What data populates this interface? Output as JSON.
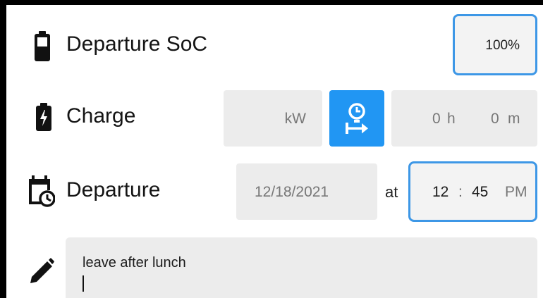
{
  "departure_soc": {
    "label": "Departure SoC",
    "value": "100%",
    "icon": "battery-full-icon"
  },
  "charge": {
    "label": "Charge",
    "icon": "battery-charging-icon",
    "power_unit": "kW",
    "power_value": "",
    "mode_icon": "timer-arrow-icon",
    "hours": "0",
    "hours_unit": "h",
    "minutes": "0",
    "minutes_unit": "m"
  },
  "departure": {
    "label": "Departure",
    "icon": "calendar-clock-icon",
    "date": "12/18/2021",
    "at_label": "at",
    "hour": "12",
    "separator": ":",
    "minute": "45",
    "meridiem": "PM"
  },
  "notes": {
    "icon": "pencil-icon",
    "text": "leave after lunch"
  },
  "colors": {
    "accent": "#2196f3",
    "focus_border": "#3d97e6",
    "field_bg": "#ececec"
  }
}
